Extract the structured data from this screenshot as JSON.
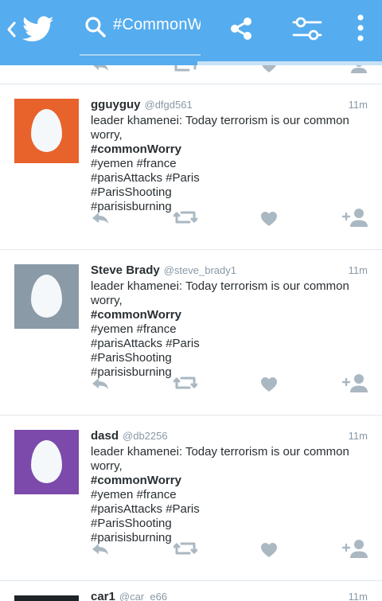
{
  "appbar": {
    "back_icon": "chevron-left-icon",
    "logo_icon": "twitter-bird-icon",
    "search_icon": "search-icon",
    "search_query": "#CommonWorry",
    "share_icon": "share-icon",
    "filter_icon": "filter-sliders-icon",
    "more_icon": "more-vertical-icon",
    "load_progress": 0.52
  },
  "colors": {
    "brand": "#55acee",
    "text": "#292f33",
    "muted": "#8899a6",
    "action_icon": "#aab8c2",
    "divider": "#e1e8ed"
  },
  "tweets": [
    {
      "name": "gguyguy",
      "handle": "@dfgd561",
      "time": "11m",
      "avatar_color": "#e8622b",
      "lines": [
        "leader khamenei: Today terrorism is our common",
        "worry,"
      ],
      "hashtag_bold": "#commonWorry",
      "tag_lines": [
        "#yemen #france",
        "#parisAttacks #Paris",
        "#ParisShooting",
        "#parisisburning"
      ]
    },
    {
      "name": "Steve Brady",
      "handle": "@steve_brady1",
      "time": "11m",
      "avatar_color": "#8a9aa6",
      "lines": [
        "leader khamenei: Today terrorism is our common",
        "worry,"
      ],
      "hashtag_bold": "#commonWorry",
      "tag_lines": [
        "#yemen #france",
        "#parisAttacks #Paris",
        "#ParisShooting",
        "#parisisburning"
      ]
    },
    {
      "name": "dasd",
      "handle": "@db2256",
      "time": "11m",
      "avatar_color": "#7b4aab",
      "lines": [
        "leader khamenei: Today terrorism is our common",
        "worry,"
      ],
      "hashtag_bold": "#commonWorry",
      "tag_lines": [
        "#yemen #france",
        "#parisAttacks #Paris",
        "#ParisShooting",
        "#parisisburning"
      ]
    }
  ],
  "partial_tweet": {
    "name": "car1",
    "handle": "@car_e66",
    "time": "11m"
  },
  "action_icons": [
    "reply-icon",
    "retweet-icon",
    "like-heart-icon",
    "follow-user-icon"
  ]
}
